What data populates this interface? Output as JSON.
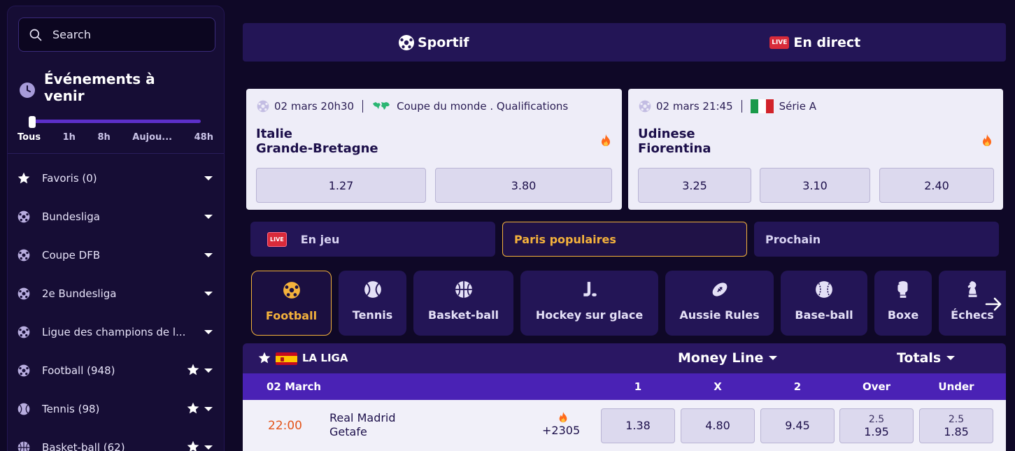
{
  "search": {
    "placeholder": "Search"
  },
  "upcoming": {
    "title": "Événements à venir",
    "time_filters": [
      "Tous",
      "1h",
      "8h",
      "Aujou...",
      "48h"
    ],
    "active_filter": "Tous"
  },
  "sidebar": {
    "items": [
      {
        "label": "Favoris (0)",
        "icon": "star-icon",
        "starred": false
      },
      {
        "label": "Bundesliga",
        "icon": "soccer-ball-icon",
        "starred": false
      },
      {
        "label": "Coupe DFB",
        "icon": "soccer-ball-icon",
        "starred": false
      },
      {
        "label": "2e Bundesliga",
        "icon": "soccer-ball-icon",
        "starred": false
      },
      {
        "label": "Ligue des champions de l...",
        "icon": "soccer-ball-icon",
        "starred": false
      },
      {
        "label": "Football (948)",
        "icon": "soccer-ball-icon",
        "starred": true
      },
      {
        "label": "Tennis (98)",
        "icon": "tennis-ball-icon",
        "starred": true
      },
      {
        "label": "Basket-ball (62)",
        "icon": "basketball-icon",
        "starred": true
      }
    ]
  },
  "topbar": {
    "sportif": "Sportif",
    "live_badge": "LIVE",
    "en_direct": "En direct"
  },
  "featured": [
    {
      "date": "02 mars 20h30",
      "competition": "Coupe du monde . Qualifications",
      "team1": "Italie",
      "team2": "Grande-Bretagne",
      "odds": [
        "1.27",
        "3.80"
      ]
    },
    {
      "date": "02 mars 21:45",
      "competition": "Série A",
      "team1": "Udinese",
      "team2": "Fiorentina",
      "odds": [
        "3.25",
        "3.10",
        "2.40"
      ]
    }
  ],
  "filters": {
    "live_badge": "LIVE",
    "en_jeu": "En jeu",
    "populaires": "Paris populaires",
    "prochain": "Prochain"
  },
  "sports": [
    "Football",
    "Tennis",
    "Basket-ball",
    "Hockey sur glace",
    "Aussie Rules",
    "Base-ball",
    "Boxe",
    "Échecs"
  ],
  "league": {
    "name": "LA LIGA",
    "market1": "Money Line",
    "market2": "Totals",
    "date": "02 March",
    "columns": [
      "1",
      "X",
      "2",
      "Over",
      "Under"
    ],
    "match": {
      "time": "22:00",
      "team1": "Real Madrid",
      "team2": "Getafe",
      "markets_count": "+2305",
      "odds": [
        "1.38",
        "4.80",
        "9.45"
      ],
      "over_line": "2.5",
      "over_odd": "1.95",
      "under_line": "2.5",
      "under_odd": "1.85"
    }
  },
  "colors": {
    "accent": "#f4b23c",
    "background": "#0f0827",
    "panel": "#231556",
    "live": "#d92b3a",
    "time": "#e3541a"
  }
}
